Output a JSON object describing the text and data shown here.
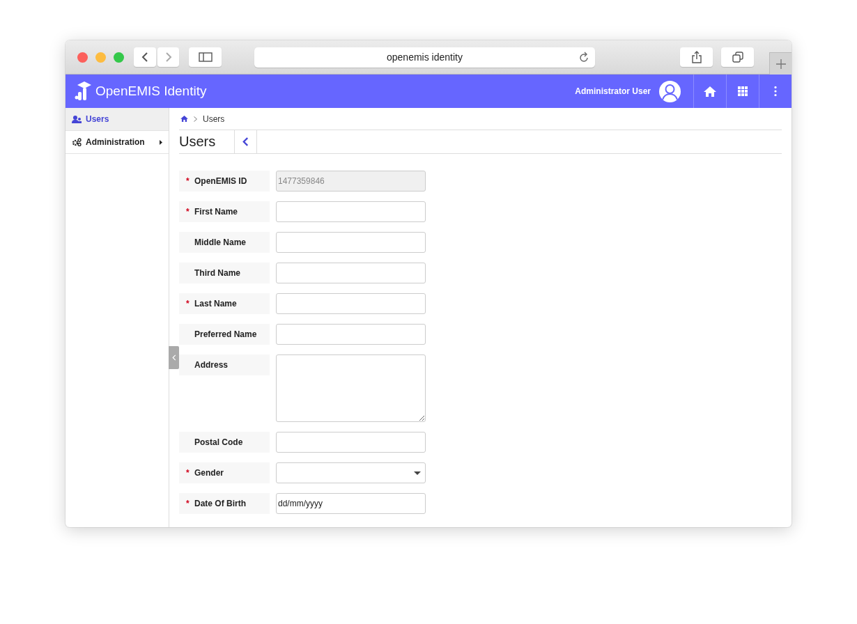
{
  "browser": {
    "address": "openemis identity"
  },
  "header": {
    "title": "OpenEMIS Identity",
    "user": "Administrator User"
  },
  "sidebar": {
    "items": [
      {
        "label": "Users",
        "selected": true,
        "kind": "users",
        "has_submenu": false
      },
      {
        "label": "Administration",
        "selected": false,
        "kind": "settings",
        "has_submenu": true
      }
    ]
  },
  "breadcrumb": {
    "current": "Users"
  },
  "page": {
    "title": "Users"
  },
  "form": {
    "fields": [
      {
        "label": "OpenEMIS ID",
        "required_mark": "*",
        "kind": "readonly",
        "value": "1477359846"
      },
      {
        "label": "First Name",
        "required_mark": "*",
        "kind": "text"
      },
      {
        "label": "Middle Name",
        "kind": "text"
      },
      {
        "label": "Third Name",
        "kind": "text"
      },
      {
        "label": "Last Name",
        "required_mark": "*",
        "kind": "text"
      },
      {
        "label": "Preferred Name",
        "kind": "text"
      },
      {
        "label": "Address",
        "kind": "textarea"
      },
      {
        "label": "Postal Code",
        "kind": "text"
      },
      {
        "label": "Gender",
        "required_mark": "*",
        "kind": "select"
      },
      {
        "label": "Date Of Birth",
        "required_mark": "*",
        "kind": "date",
        "value": "dd/mm/yyyy"
      }
    ]
  }
}
